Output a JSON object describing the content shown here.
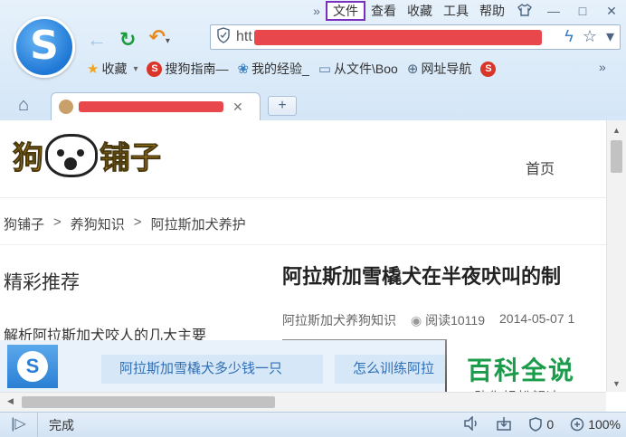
{
  "menubar": {
    "overflow": "»",
    "items": [
      {
        "label": "文件",
        "active": true
      },
      {
        "label": "查看"
      },
      {
        "label": "收藏"
      },
      {
        "label": "工具"
      },
      {
        "label": "帮助"
      }
    ],
    "skin_icon": "shirt-icon",
    "minimize": "—",
    "maximize": "□",
    "close": "✕"
  },
  "browser": {
    "logo_letter": "S"
  },
  "nav": {
    "back": "←",
    "refresh": "↻",
    "undo": "↶",
    "undo_dropdown": "▾"
  },
  "address": {
    "visible_text": "htt",
    "bolt": "ϟ",
    "star": "☆",
    "dropdown": "▾"
  },
  "bookmarks": [
    {
      "icon": "star-icon",
      "glyph": "★",
      "label": "收藏",
      "suffix": "▾"
    },
    {
      "icon": "sogou-icon",
      "glyph": "S",
      "label": "搜狗指南—"
    },
    {
      "icon": "paw-icon",
      "glyph": "❀",
      "label": "我的经验_"
    },
    {
      "icon": "folder-icon",
      "glyph": "▭",
      "label": "从文件\\Boo"
    },
    {
      "icon": "globe-icon",
      "glyph": "⊕",
      "label": "网址导航"
    },
    {
      "icon": "sina-icon",
      "glyph": "S",
      "label": ""
    }
  ],
  "bookmarks_more": "»",
  "tabs": {
    "home": "⌂",
    "close": "✕",
    "new_tab": "+"
  },
  "page": {
    "logo_left": "狗",
    "logo_right": "铺子",
    "home_link": "首页",
    "breadcrumb": [
      "狗铺子",
      ">",
      "养狗知识",
      ">",
      "阿拉斯加犬养护"
    ],
    "sidebar_title": "精彩推荐",
    "sidebar_item": "解析阿拉斯加犬咬人的几大主要",
    "article_title": "阿拉斯加雪橇犬在半夜吠叫的制",
    "article_category": "阿拉斯加犬养狗知识",
    "article_reads": "阅读10119",
    "article_date": "2014-05-07 1"
  },
  "suggest": {
    "logo_letter": "S",
    "chip1": "阿拉斯加雪橇犬多少钱一只",
    "chip2": "怎么训练阿拉"
  },
  "baike": {
    "title": "百科全说",
    "subtitle": "助你轻松解决"
  },
  "statusbar": {
    "toggle": "|▷",
    "status": "完成",
    "sound": "🔈",
    "ad_count": "0",
    "zoom": "100%"
  }
}
